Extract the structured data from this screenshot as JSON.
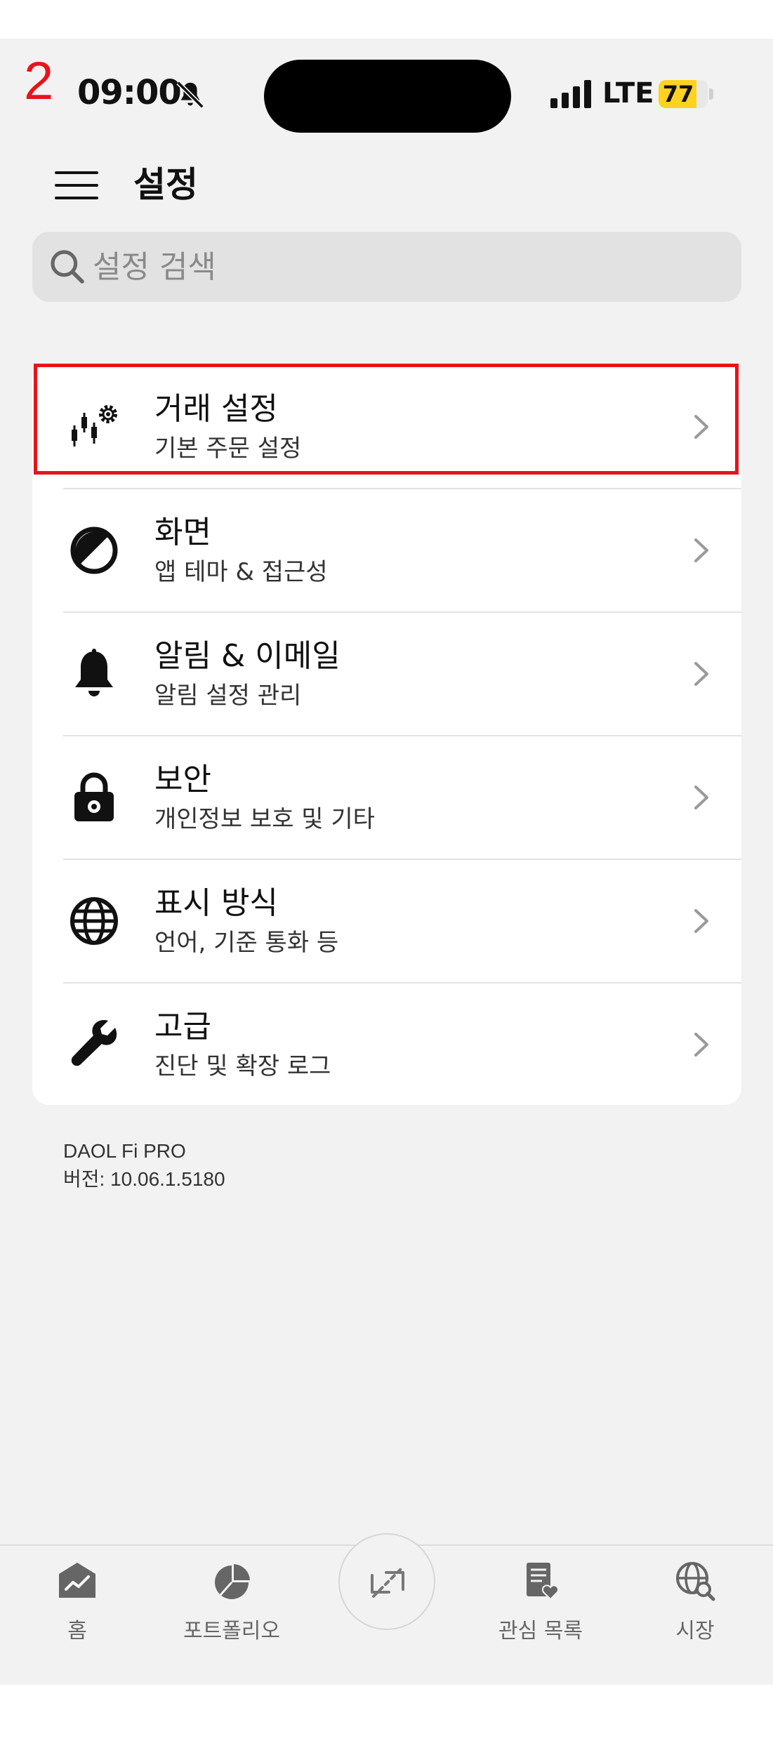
{
  "annotation": {
    "page_number": "2"
  },
  "status_bar": {
    "time": "09:00",
    "carrier": "LTE",
    "battery_level": "77",
    "battery_color": "#ffd21f"
  },
  "header": {
    "title": "설정",
    "menu_icon": "hamburger-menu-icon"
  },
  "search": {
    "placeholder": "설정 검색",
    "value": ""
  },
  "settings": {
    "items": [
      {
        "title": "거래 설정",
        "subtitle": "기본 주문 설정",
        "icon": "trading-settings-icon",
        "highlighted": true
      },
      {
        "title": "화면",
        "subtitle": "앱 테마 & 접근성",
        "icon": "contrast-icon"
      },
      {
        "title": "알림 & 이메일",
        "subtitle": "알림 설정 관리",
        "icon": "bell-icon"
      },
      {
        "title": "보안",
        "subtitle": "개인정보 보호 및 기타",
        "icon": "lock-icon"
      },
      {
        "title": "표시 방식",
        "subtitle": "언어, 기준 통화 등",
        "icon": "globe-icon"
      },
      {
        "title": "고급",
        "subtitle": "진단 및 확장 로그",
        "icon": "wrench-icon"
      }
    ]
  },
  "footer": {
    "app_name": "DAOL Fi PRO",
    "version": "버전: 10.06.1.5180"
  },
  "tab_bar": {
    "tabs": [
      {
        "label": "홈",
        "icon": "home-chart-icon"
      },
      {
        "label": "포트폴리오",
        "icon": "pie-chart-icon"
      },
      {
        "label": "",
        "icon": "trade-arrows-icon"
      },
      {
        "label": "관심 목록",
        "icon": "watchlist-heart-icon"
      },
      {
        "label": "시장",
        "icon": "globe-search-icon"
      }
    ]
  },
  "colors": {
    "highlight": "#e8131b",
    "background": "#f2f2f2",
    "card": "#ffffff"
  }
}
